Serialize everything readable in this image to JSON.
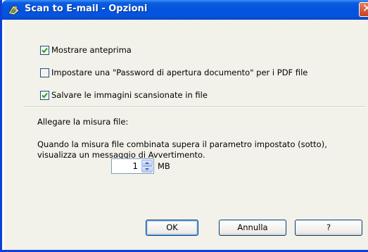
{
  "window": {
    "title": "Scan to E-mail - Opzioni"
  },
  "options": [
    {
      "label": "Mostrare anteprima",
      "checked": true
    },
    {
      "label": "Impostare una \"Password di apertura documento\" per i PDF file",
      "checked": false
    },
    {
      "label": "Salvare le immagini scansionate in file",
      "checked": true
    }
  ],
  "attach": {
    "heading": "Allegare la misura file:",
    "description_line1": "Quando la misura file combinata supera il parametro impostato (sotto),",
    "description_line2": "visualizza un messaggio di Avvertimento.",
    "size_value": "1",
    "size_unit": "MB"
  },
  "buttons": {
    "ok": "OK",
    "cancel": "Annulla",
    "help": "?"
  },
  "colors": {
    "titlebar": "#0353dc",
    "dialog_bg": "#f2f1ea",
    "check": "#21a121"
  }
}
